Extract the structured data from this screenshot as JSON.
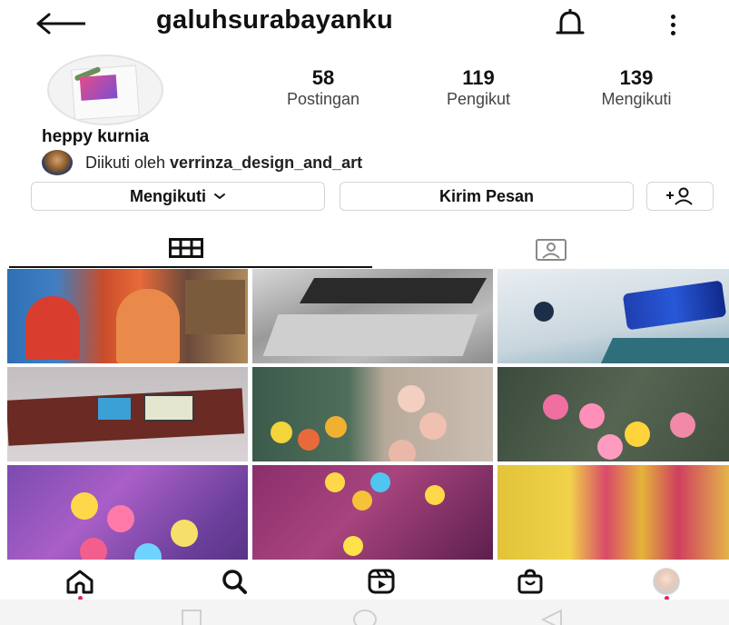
{
  "header": {
    "username": "galuhsurabayanku"
  },
  "profile": {
    "stats": [
      {
        "value": "58",
        "label": "Postingan"
      },
      {
        "value": "119",
        "label": "Pengikut"
      },
      {
        "value": "139",
        "label": "Mengikuti"
      }
    ],
    "full_name": "heppy kurnia",
    "followed_by_prefix": "Diikuti oleh ",
    "followed_by_user": "verrinza_design_and_art"
  },
  "buttons": {
    "following_label": "Mengikuti",
    "message_label": "Kirim Pesan"
  },
  "colors": {
    "text": "#111111",
    "secondary_text": "#444444",
    "border": "#d4d4d4",
    "notification_dot": "#e0245e"
  },
  "icons": {
    "back": "arrow-left-icon",
    "notifications": "bell-icon",
    "more": "more-vertical-icon",
    "follow_dropdown": "chevron-down-icon",
    "suggest": "add-person-icon",
    "tab_posts": "grid-icon",
    "tab_tagged": "tagged-person-icon",
    "nav": [
      "home-icon",
      "search-icon",
      "reels-icon",
      "shop-icon",
      "profile-avatar"
    ],
    "system": [
      "recents-icon",
      "home-circle-icon",
      "back-triangle-icon"
    ]
  }
}
